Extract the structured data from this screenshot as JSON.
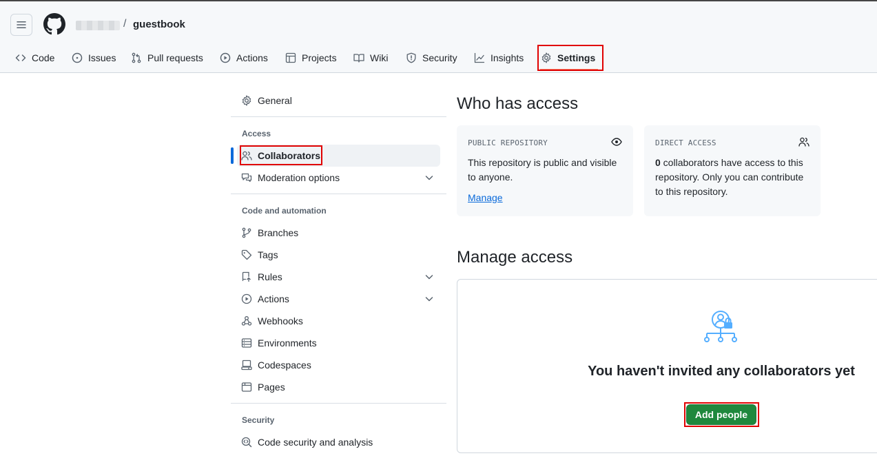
{
  "header": {
    "repo_name": "guestbook",
    "separator": "/"
  },
  "tabs": [
    {
      "label": "Code",
      "icon": "code-icon"
    },
    {
      "label": "Issues",
      "icon": "issue-icon"
    },
    {
      "label": "Pull requests",
      "icon": "pull-request-icon"
    },
    {
      "label": "Actions",
      "icon": "play-icon"
    },
    {
      "label": "Projects",
      "icon": "table-icon"
    },
    {
      "label": "Wiki",
      "icon": "book-icon"
    },
    {
      "label": "Security",
      "icon": "shield-icon"
    },
    {
      "label": "Insights",
      "icon": "graph-icon"
    },
    {
      "label": "Settings",
      "icon": "gear-icon",
      "active": true
    }
  ],
  "sidebar": {
    "general": "General",
    "access_heading": "Access",
    "collaborators": "Collaborators",
    "moderation": "Moderation options",
    "code_heading": "Code and automation",
    "branches": "Branches",
    "tags": "Tags",
    "rules": "Rules",
    "actions": "Actions",
    "webhooks": "Webhooks",
    "environments": "Environments",
    "codespaces": "Codespaces",
    "pages": "Pages",
    "security_heading": "Security",
    "code_security": "Code security and analysis"
  },
  "main": {
    "who_title": "Who has access",
    "public_card": {
      "label": "PUBLIC REPOSITORY",
      "line1": "This repository is public and visible",
      "line2": "to anyone.",
      "link": "Manage"
    },
    "direct_card": {
      "label": "DIRECT ACCESS",
      "count": "0",
      "line1": " collaborators have access to this",
      "line2": "repository. Only you can contribute",
      "line3": "to this repository."
    },
    "manage_title": "Manage access",
    "empty_title": "You haven't invited any collaborators yet",
    "add_button": "Add people"
  },
  "colors": {
    "accent_blue": "#0969da",
    "primary_green": "#1f883d",
    "highlight_red": "#e00000",
    "tab_underline": "#fd8c73"
  }
}
